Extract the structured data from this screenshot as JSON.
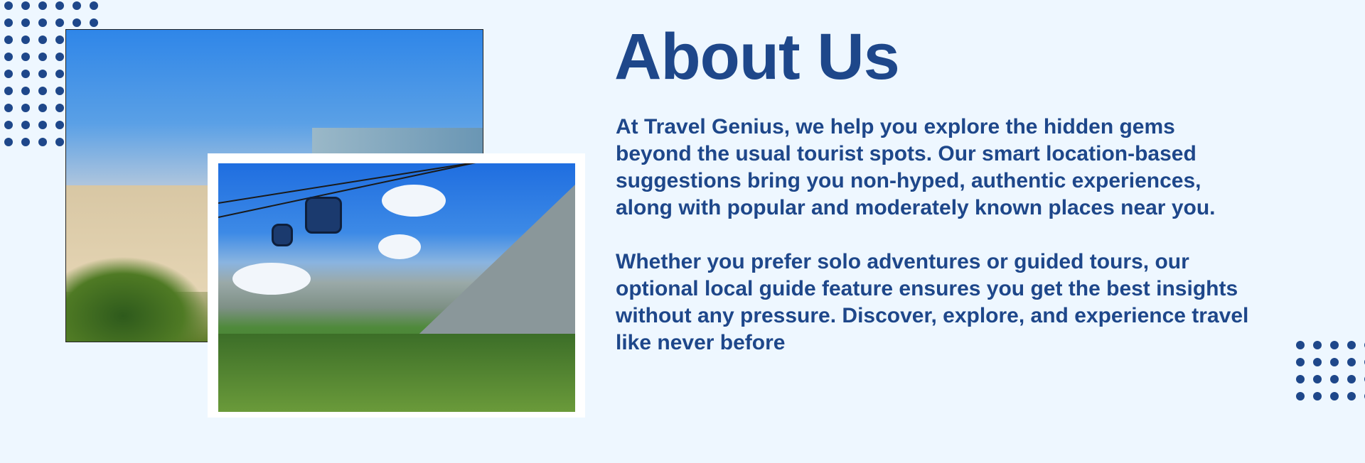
{
  "section": {
    "title": "About Us",
    "paragraphs": [
      "At Travel Genius, we help you explore the hidden gems beyond the usual tourist spots. Our smart location-based suggestions bring you non-hyped, authentic experiences, along with popular and moderately known places near you.",
      "Whether you prefer solo adventures or guided tours, our optional local guide feature ensures you get the best insights without any pressure. Discover, explore, and experience travel like never before"
    ]
  },
  "images": {
    "beach": "beach-photo",
    "mountain": "mountain-cable-car-photo"
  },
  "colors": {
    "background": "#eef7ff",
    "accent": "#1e478a"
  }
}
